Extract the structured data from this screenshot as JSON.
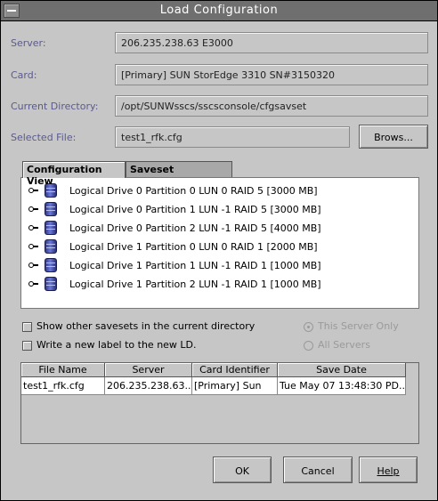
{
  "window": {
    "title": "Load Configuration"
  },
  "form": {
    "server_label": "Server:",
    "server_value": "206.235.238.63 E3000",
    "card_label": "Card:",
    "card_value": "[Primary] SUN StorEdge 3310 SN#3150320",
    "dir_label": "Current Directory:",
    "dir_value": "/opt/SUNWsscs/sscsconsole/cfgsavset",
    "file_label": "Selected File:",
    "file_value": "test1_rfk.cfg",
    "browse_label": "Brows..."
  },
  "tabs": [
    {
      "label": "Configuration View",
      "active": true
    },
    {
      "label": "Saveset Description",
      "active": false
    }
  ],
  "tree": [
    "Logical Drive 0 Partition 0 LUN 0 RAID 5 [3000 MB]",
    "Logical Drive 0 Partition 1 LUN -1 RAID 5 [3000 MB]",
    "Logical Drive 0 Partition 2 LUN -1 RAID 5 [4000 MB]",
    "Logical Drive 1 Partition 0 LUN 0 RAID 1 [2000 MB]",
    "Logical Drive 1 Partition 1 LUN -1 RAID 1 [1000 MB]",
    "Logical Drive 1 Partition 2 LUN -1 RAID 1 [1000 MB]"
  ],
  "options": {
    "show_other": "Show other savesets in the current directory",
    "write_label": "Write a new label to the new LD.",
    "this_server": "This Server Only",
    "all_servers": "All Servers"
  },
  "table": {
    "headers": [
      "File Name",
      "Server",
      "Card Identifier",
      "Save Date"
    ],
    "rows": [
      [
        "test1_rfk.cfg",
        "206.235.238.63...",
        "[Primary] Sun",
        "Tue May 07 13:48:30 PD..."
      ]
    ]
  },
  "buttons": {
    "ok": "OK",
    "cancel": "Cancel",
    "help": "Help"
  },
  "colors": {
    "titlebar": "#6f6f6f",
    "label": "#5a5a8c",
    "background": "#c6c6c6"
  }
}
